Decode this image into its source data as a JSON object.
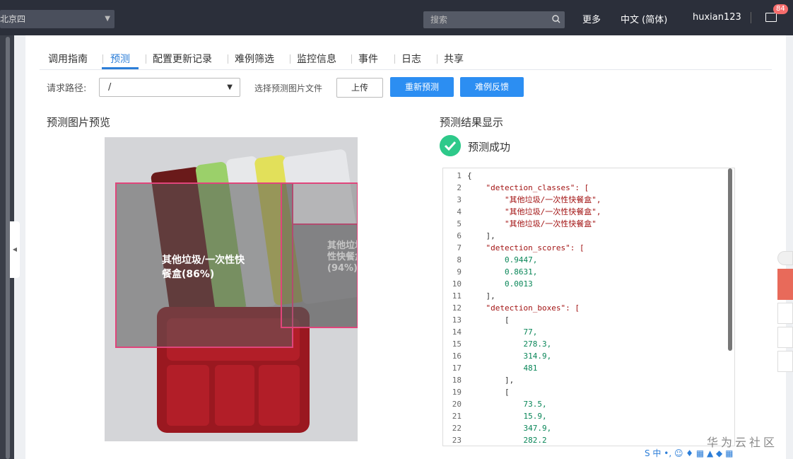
{
  "topbar": {
    "region": "北京四",
    "search_placeholder": "搜索",
    "more": "更多",
    "language": "中文 (简体)",
    "username": "huxian123",
    "mail_badge": "84"
  },
  "tabs": [
    "调用指南",
    "预测",
    "配置更新记录",
    "难例筛选",
    "监控信息",
    "事件",
    "日志",
    "共享"
  ],
  "form": {
    "path_label": "请求路径:",
    "path_value": "/",
    "file_label": "选择预测图片文件",
    "upload": "上传",
    "repredict": "重新预测",
    "feedback": "难例反馈"
  },
  "preview": {
    "title": "预测图片预览",
    "boxes": [
      {
        "label_line1": "其他垃圾/一次性快",
        "label_line2": "餐盒(86%)"
      },
      {
        "label_line1": "其他垃圾/一次",
        "label_line2": "性快餐盒",
        "label_line3": "(94%)"
      }
    ]
  },
  "result": {
    "title": "预测结果显示",
    "status": "预测成功",
    "code_lines": [
      {
        "n": "1",
        "t": "{"
      },
      {
        "n": "2",
        "t": "    \"detection_classes\": ["
      },
      {
        "n": "3",
        "t": "        \"其他垃圾/一次性快餐盒\","
      },
      {
        "n": "4",
        "t": "        \"其他垃圾/一次性快餐盒\","
      },
      {
        "n": "5",
        "t": "        \"其他垃圾/一次性快餐盒\""
      },
      {
        "n": "6",
        "t": "    ],"
      },
      {
        "n": "7",
        "t": "    \"detection_scores\": ["
      },
      {
        "n": "8",
        "t": "        0.9447,"
      },
      {
        "n": "9",
        "t": "        0.8631,"
      },
      {
        "n": "10",
        "t": "        0.0013"
      },
      {
        "n": "11",
        "t": "    ],"
      },
      {
        "n": "12",
        "t": "    \"detection_boxes\": ["
      },
      {
        "n": "13",
        "t": "        ["
      },
      {
        "n": "14",
        "t": "            77,"
      },
      {
        "n": "15",
        "t": "            278.3,"
      },
      {
        "n": "16",
        "t": "            314.9,"
      },
      {
        "n": "17",
        "t": "            481"
      },
      {
        "n": "18",
        "t": "        ],"
      },
      {
        "n": "19",
        "t": "        ["
      },
      {
        "n": "20",
        "t": "            73.5,"
      },
      {
        "n": "21",
        "t": "            15.9,"
      },
      {
        "n": "22",
        "t": "            347.9,"
      },
      {
        "n": "23",
        "t": "            282.2"
      }
    ]
  },
  "watermark": "华为云社区",
  "colors": {
    "accent": "#2c8ef2",
    "success": "#2ec98a",
    "box": "#e0457b",
    "badge": "#f56c6c"
  }
}
